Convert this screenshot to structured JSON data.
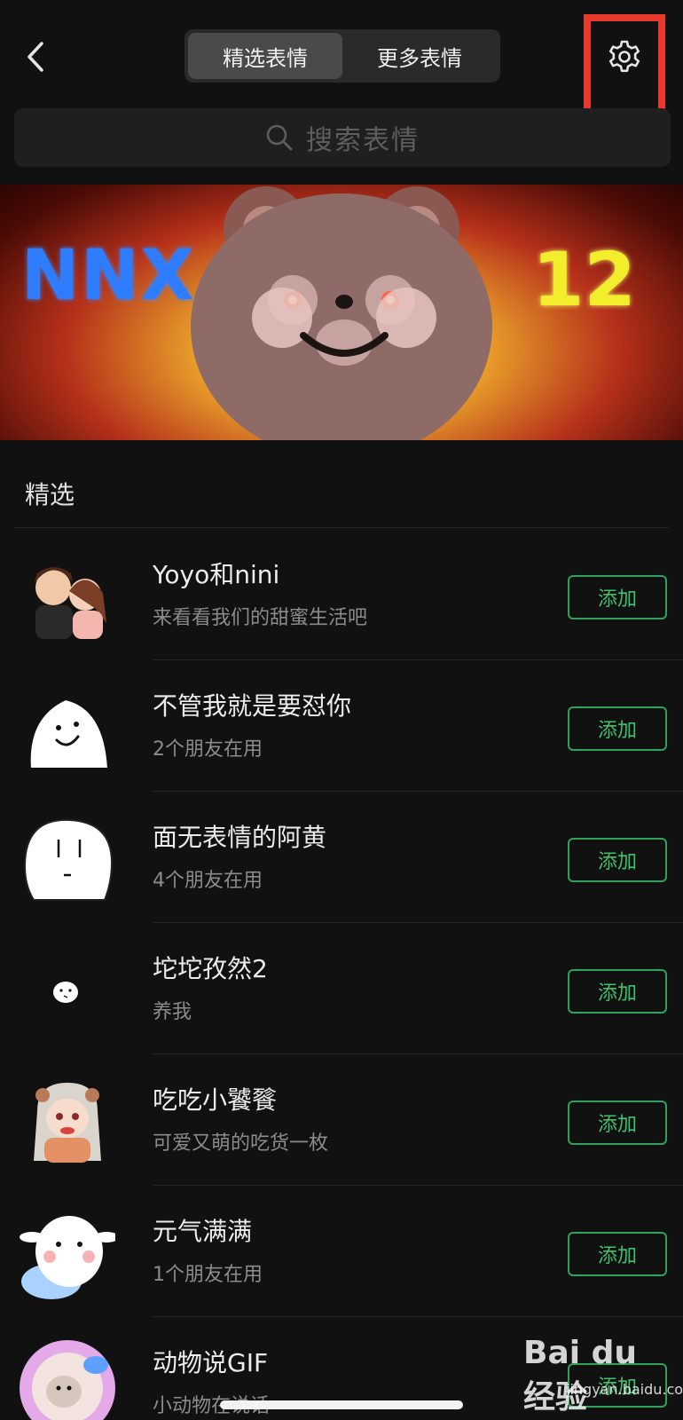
{
  "header": {
    "tabs": [
      {
        "label": "精选表情",
        "active": true
      },
      {
        "label": "更多表情",
        "active": false
      }
    ]
  },
  "search": {
    "placeholder": "搜索表情"
  },
  "banner": {
    "left_text": "NNX",
    "right_text": "12"
  },
  "section": {
    "title": "精选"
  },
  "items": [
    {
      "title": "Yoyo和nini",
      "subtitle": "来看看我们的甜蜜生活吧",
      "action": "添加"
    },
    {
      "title": "不管我就是要怼你",
      "subtitle": "2个朋友在用",
      "action": "添加"
    },
    {
      "title": "面无表情的阿黄",
      "subtitle": "4个朋友在用",
      "action": "添加"
    },
    {
      "title": "坨坨孜然2",
      "subtitle": "养我",
      "action": "添加"
    },
    {
      "title": "吃吃小饕餮",
      "subtitle": "可爱又萌的吃货一枚",
      "action": "添加"
    },
    {
      "title": "元气满满",
      "subtitle": "1个朋友在用",
      "action": "添加"
    },
    {
      "title": "动物说GIF",
      "subtitle": "小动物在说话",
      "action": "添加"
    }
  ],
  "watermark": {
    "brand": "Bai du 经验",
    "url": "jingyan.baidu.com"
  },
  "colors": {
    "accent_green": "#2fa25a",
    "highlight_red": "#e8392c",
    "background": "#111111"
  }
}
